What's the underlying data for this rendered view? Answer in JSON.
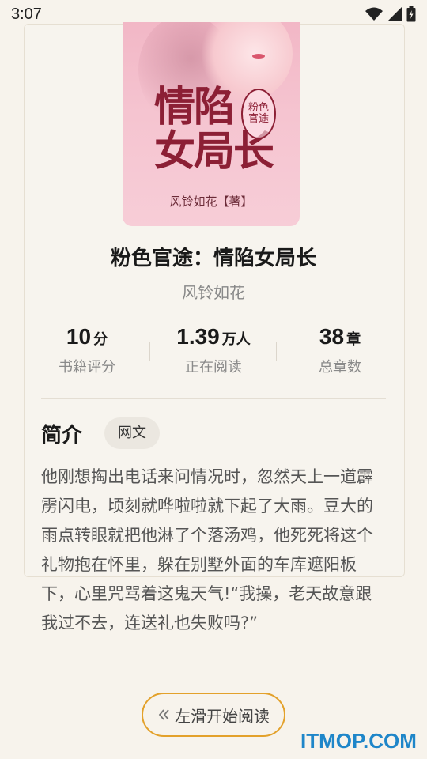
{
  "status_bar": {
    "time": "3:07",
    "icons": [
      "wifi-icon",
      "signal-icon",
      "battery-icon"
    ]
  },
  "cover": {
    "title_line1": "情陷",
    "title_line2": "女局长",
    "seal_text": "粉色官途",
    "author_line": "风铃如花【著】"
  },
  "book": {
    "title": "粉色官途：情陷女局长",
    "author": "风铃如花"
  },
  "stats": [
    {
      "value": "10",
      "unit": "分",
      "label": "书籍评分"
    },
    {
      "value": "1.39",
      "unit": "万人",
      "label": "正在阅读"
    },
    {
      "value": "38",
      "unit": "章",
      "label": "总章数"
    }
  ],
  "intro": {
    "heading": "简介",
    "tag": "网文",
    "text": "他刚想掏出电话来问情况时，忽然天上一道霹雳闪电，顷刻就哗啦啦就下起了大雨。豆大的雨点转眼就把他淋了个落汤鸡，他死死将这个礼物抱在怀里，躲在别墅外面的车库遮阳板下，心里咒骂着这鬼天气!“我操，老天故意跟我过不去，连送礼也失败吗?”"
  },
  "action": {
    "start_label": "左滑开始阅读",
    "icon": "double-chevron-left-icon"
  },
  "watermark": "ITMOP.COM",
  "colors": {
    "background": "#f7f3ec",
    "accent": "#e3a12b",
    "watermark": "#1f86c9",
    "cover_title": "#8c1f35"
  }
}
